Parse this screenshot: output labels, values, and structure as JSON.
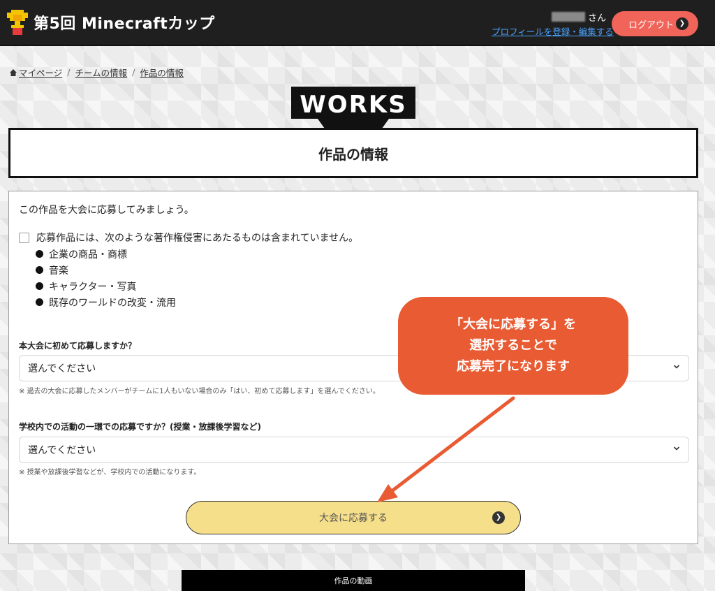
{
  "header": {
    "brand": "第5回 Minecraftカップ",
    "username_suffix": "さん",
    "profile_link": "プロフィールを登録・編集する",
    "logout_label": "ログアウト"
  },
  "breadcrumb": {
    "items": [
      "マイページ",
      "チームの情報",
      "作品の情報"
    ],
    "separator": "/"
  },
  "logo_text": "WORKS",
  "page_title": "作品の情報",
  "form": {
    "intro": "この作品を大会に応募してみましょう。",
    "agreement_label": "応募作品には、次のような著作権侵害にあたるものは含まれていません。",
    "agreement_checked": false,
    "agreement_items": [
      "企業の商品・商標",
      "音楽",
      "キャラクター・写真",
      "既存のワールドの改変・流用"
    ],
    "q1": {
      "label": "本大会に初めて応募しますか？",
      "selected": "選んでください",
      "note": "※ 過去の大会に応募したメンバーがチームに1人もいない場合のみ「はい、初めて応募します」を選んでください。"
    },
    "q2": {
      "label": "学校内での活動の一環での応募ですか？(授業・放課後学習など)",
      "selected": "選んでください",
      "note": "※ 授業や放課後学習などが、学校内での活動になります。"
    },
    "submit_label": "大会に応募する"
  },
  "callout": {
    "lines": [
      "「大会に応募する」を",
      "選択することで",
      "応募完了になります"
    ]
  },
  "video_section_title": "作品の動画",
  "colors": {
    "header_bg": "#1f1f1f",
    "logout_btn": "#f0645a",
    "submit_btn": "#f6df8a",
    "callout": "#e85b33",
    "link": "#4aa3ff"
  },
  "icons": {
    "brand": "trophy-icon",
    "breadcrumb_home": "home-icon",
    "logout": "arrow-right-circle-icon",
    "select": "chevron-down-icon",
    "submit": "arrow-right-circle-icon"
  }
}
